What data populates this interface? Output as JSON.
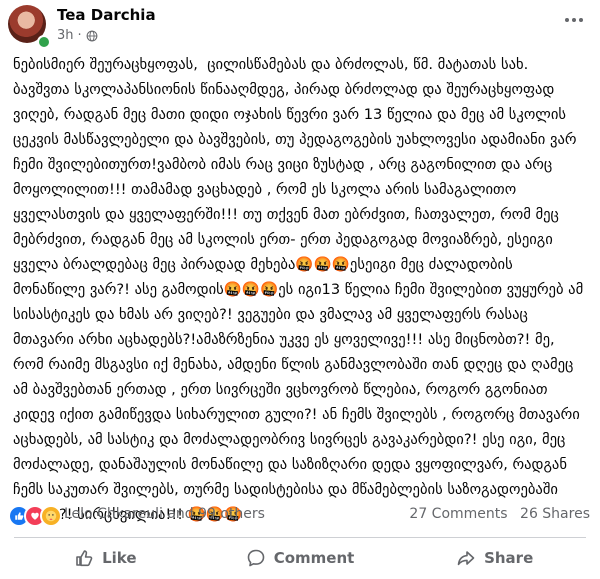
{
  "post": {
    "author": "Tea Darchia",
    "time": "3h",
    "separator": "·",
    "audience_icon": "globe-icon",
    "body": "ნებისმიერ შეურაცხყოფას,  ცილისწამებას და ბრძოლას, წმ. მატათას სახ. ბავშვთა სკოლაპანსიონის წინააღმდეგ, პირად ბრძოლად და შეურაცხყოფად ვიღებ, რადგან მეც მათი დიდი ოჯახის წევრი ვარ 13 წელია და მეც ამ სკოლის ცეკვის მასწავლებელი და ბავშვების, თუ პედაგოგების უახლოვესი ადამიანი ვარ ჩემი შვილებითურთ!ვამბობ იმას რაც ვიცი ზუსტად , არც გაგონილით და არც მოყოლილით!!! თამამად ვაცხადებ , რომ ეს სკოლა არის სამაგალითო ყველასთვის და ყველაფერში!!! თუ თქვენ მათ ებრძვით, ჩათვალეთ, რომ მეც მებრძვით, რადგან მეც ამ სკოლის ერთ- ერთ პედაგოგად მოვიაზრებ, ესეიგი ყველა ბრალდებაც მეც პირადად მეხება🤬🤬🤬ესეიგი მეც ძალადობის მონაწილე ვარ?! ასე გამოდის🤬🤬🤬ეს იგი13 წელია ჩემი შვილებით ვუყურებ ამ სისასტიკეს და ხმას არ ვიღებ?! ვეგუები და ვმალავ ამ ყველაფერს რასაც მთავარი არხი აცხადებს?!ამაზრზენია უკვე ეს ყოველივე!!! ასე მიცნობთ?! მე, რომ რაიმე მსგავსი იქ მენახა, ამდენი წლის განმავლობაში თან დღეც და ღამეც ამ ბავშვებთან ერთად , ერთ სივრცეში ვცხოვრობ წლებია, როგორ გგონიათ კიდევ იქით გამიწევდა სიხარულით გული?! ან ჩემს შვილებს , როგორც მთავარი აცხადებს, ამ სასტიკ და მოძალადეობრივ სივრცეს გავაკარებდი?! ესე იგი, მეც მოძალადე, დანაშაულის მონაწილე და საზიზღარი დედა ვყოფილვარ, რადგან ჩემს საკუთარ შვილებს, თურმე სადისტებისა და მწამებლების საზოგადოებაში ვზრდი?! სირცხვილია!!! 🤬🤬🤬"
  },
  "reactions": {
    "icons": [
      "like-reaction-icon",
      "love-reaction-icon",
      "care-reaction-icon"
    ],
    "names": "Lelo Chkareuli and 99 others",
    "comments": "27 Comments",
    "shares": "26 Shares"
  },
  "actions": {
    "like": "Like",
    "comment": "Comment",
    "share": "Share"
  },
  "colors": {
    "primary_text": "#050505",
    "secondary_text": "#65676b",
    "like_blue": "#1877f2",
    "love_red": "#f33e58",
    "care_yellow": "#f7b125",
    "online_green": "#31a24c"
  }
}
